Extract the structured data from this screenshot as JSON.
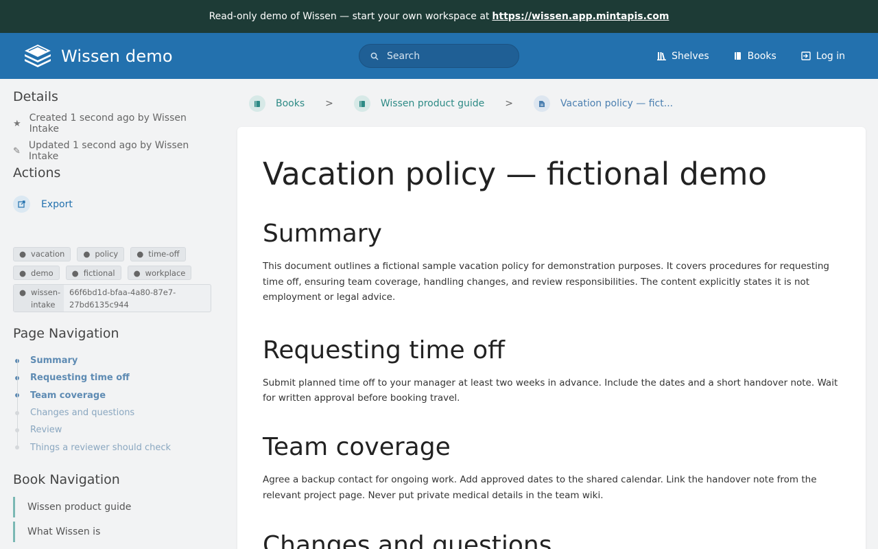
{
  "banner": {
    "text": "Read-only demo of Wissen — start your own workspace at",
    "link": "https://wissen.app.mintapis.com"
  },
  "header": {
    "app_name": "Wissen demo",
    "search_placeholder": "Search",
    "nav": {
      "shelves": "Shelves",
      "books": "Books",
      "login": "Log in"
    }
  },
  "details": {
    "heading": "Details",
    "created": "Created 1 second ago by Wissen Intake",
    "updated": "Updated 1 second ago by Wissen Intake"
  },
  "actions": {
    "heading": "Actions",
    "export": "Export"
  },
  "tags": {
    "t1": "vacation",
    "t2": "policy",
    "t3": "time-off",
    "t4": "demo",
    "t5": "fictional",
    "t6": "workplace",
    "t7_key": "wissen-intake",
    "t7_value": "66f6bd1d-bfaa-4a80-87e7-27bd6135c944"
  },
  "page_nav": {
    "heading": "Page Navigation",
    "i1": "Summary",
    "i2": "Requesting time off",
    "i3": "Team coverage",
    "i4": "Changes and questions",
    "i5": "Review",
    "i6": "Things a reviewer should check"
  },
  "book_nav": {
    "heading": "Book Navigation",
    "i1": "Wissen product guide",
    "i2": "What Wissen is"
  },
  "breadcrumbs": {
    "c1": "Books",
    "c2": "Wissen product guide",
    "c3": "Vacation policy — fict...",
    "sep": ">"
  },
  "content": {
    "title": "Vacation policy — fictional demo",
    "s1_heading": "Summary",
    "s1_body": "This document outlines a fictional sample vacation policy for demonstration purposes. It covers procedures for requesting time off, ensuring team coverage, handling changes, and review responsibilities. The content explicitly states it is not employment or legal advice.",
    "s2_heading": "Requesting time off",
    "s2_body": "Submit planned time off to your manager at least two weeks in advance. Include the dates and a short handover note. Wait for written approval before booking travel.",
    "s3_heading": "Team coverage",
    "s3_body": "Agree a backup contact for ongoing work. Add approved dates to the shared calendar. Link the handover note from the relevant project page. Never put private medical details in the team wiki.",
    "s4_heading": "Changes and questions"
  },
  "colors": {
    "banner": "#1d3b36",
    "header": "#2371ae",
    "accent_teal": "#2d8a85",
    "link_blue": "#2371ae"
  }
}
